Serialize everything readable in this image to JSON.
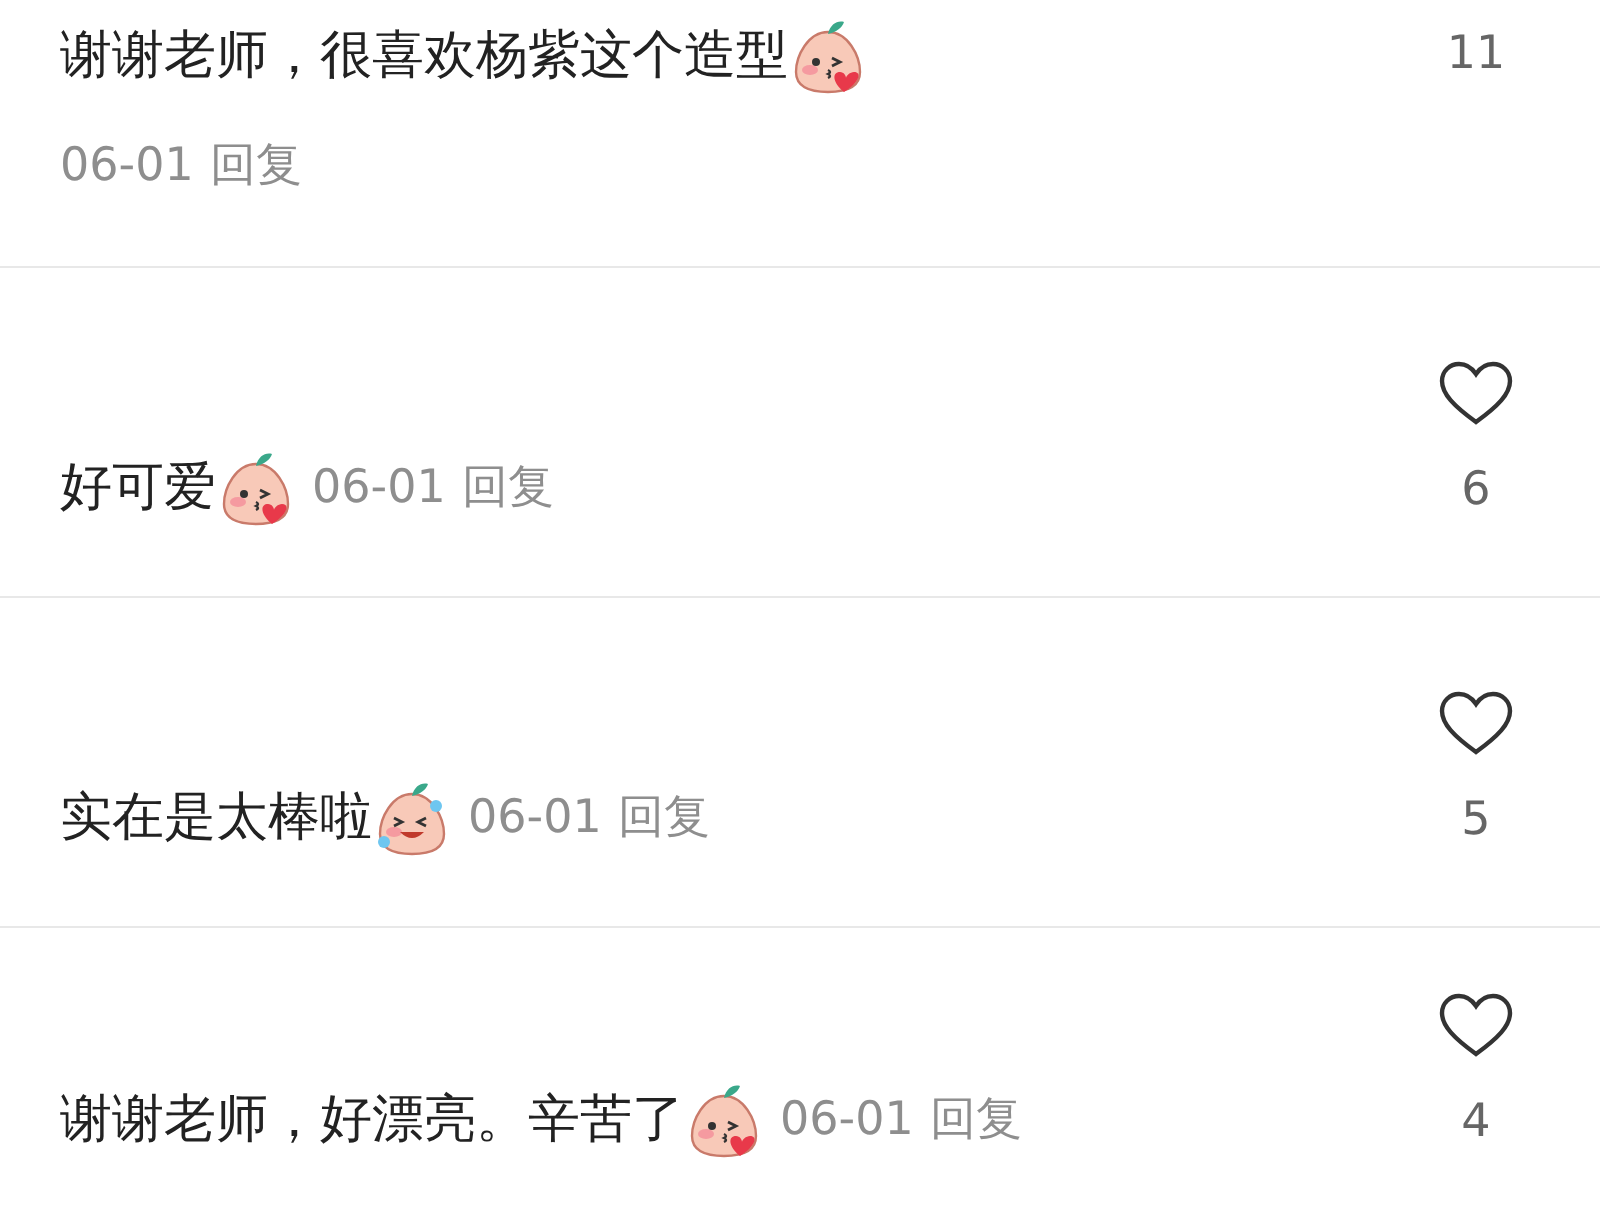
{
  "comments": [
    {
      "kind": "stacked",
      "text": "谢谢老师，很喜欢杨紫这个造型",
      "emoji": {
        "kind": "kiss"
      },
      "date": "06-01",
      "reply": "回复",
      "likes": "11"
    },
    {
      "kind": "inline",
      "text": "好可爱",
      "emoji": {
        "kind": "kiss"
      },
      "date": "06-01",
      "reply": "回复",
      "likes": "6",
      "liked": false
    },
    {
      "kind": "inline",
      "text": "实在是太棒啦",
      "emoji": {
        "kind": "laugh"
      },
      "date": "06-01",
      "reply": "回复",
      "likes": "5",
      "liked": false
    },
    {
      "kind": "inline",
      "text": "谢谢老师，好漂亮。辛苦了",
      "emoji": {
        "kind": "kiss"
      },
      "date": "06-01",
      "reply": "回复",
      "likes": "4",
      "liked": false
    }
  ]
}
